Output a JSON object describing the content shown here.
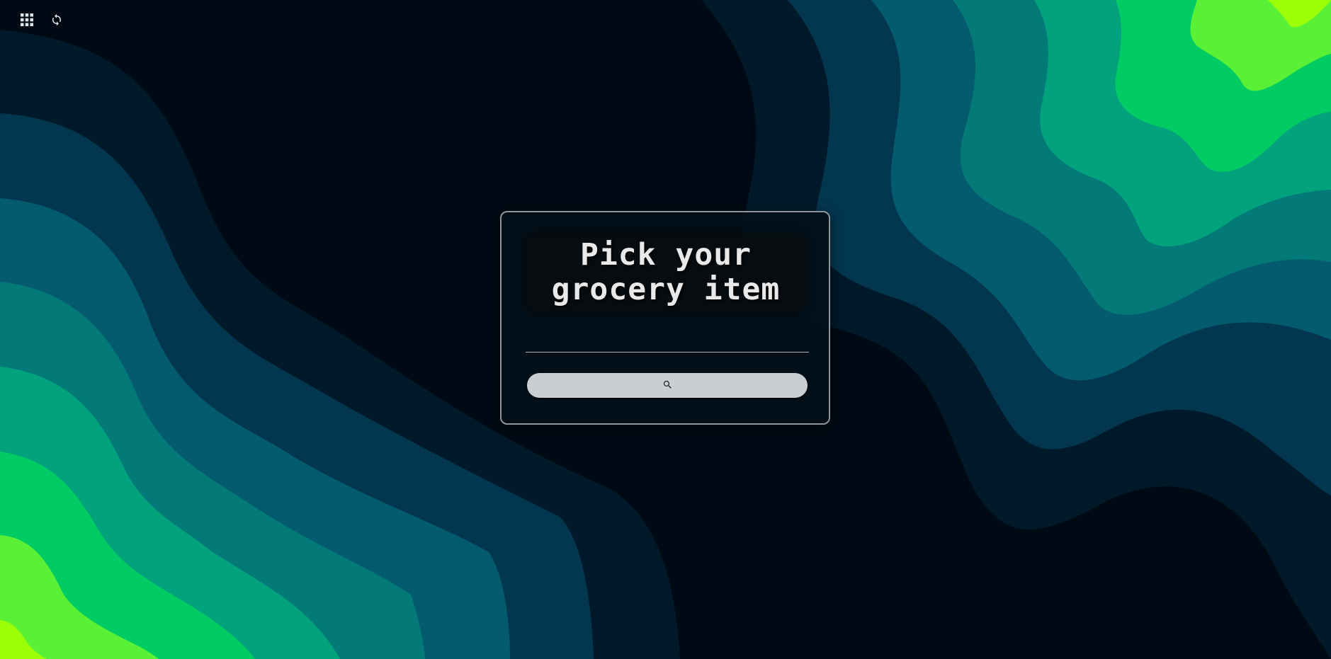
{
  "toolbar": {
    "apps_icon": "grid-icon",
    "refresh_icon": "refresh-icon"
  },
  "card": {
    "title": "Pick your\ngrocery item",
    "search_value": "",
    "search_button_icon": "search-icon"
  },
  "colors": {
    "background": "#000a14",
    "band_1": "#011a29",
    "band_2": "#033750",
    "band_3": "#045b6d",
    "band_4": "#037a78",
    "band_5": "#01a27c",
    "band_6": "#00cc63",
    "band_7": "#5af036",
    "band_8": "#9aff07",
    "card_border": "#8f959b",
    "button": "#c9ced2",
    "title_text": "#e9e9e9"
  }
}
